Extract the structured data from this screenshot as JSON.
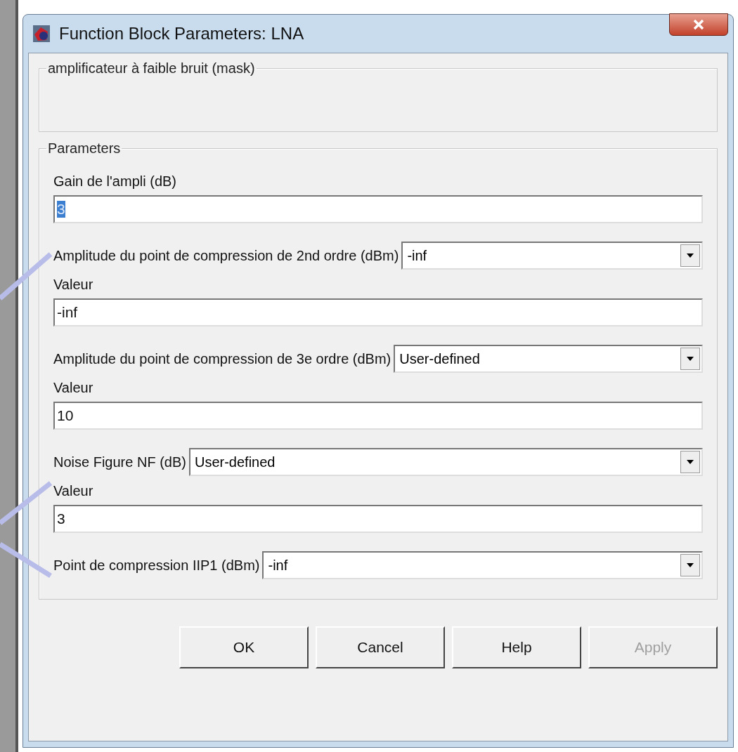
{
  "window": {
    "title": "Function Block Parameters: LNA"
  },
  "mask": {
    "title": "amplificateur à faible bruit  (mask)"
  },
  "parameters": {
    "title": "Parameters",
    "items": [
      {
        "kind": "edit",
        "label": "Gain de l'ampli (dB)",
        "value": "3",
        "selected": true
      },
      {
        "kind": "popup",
        "label": "Amplitude du point de compression de 2nd ordre (dBm)",
        "value": "-inf"
      },
      {
        "kind": "edit",
        "label": "Valeur",
        "value": "-inf",
        "selected": false
      },
      {
        "kind": "popup",
        "label": "Amplitude du point de compression de 3e ordre (dBm)",
        "value": "User-defined"
      },
      {
        "kind": "edit",
        "label": "Valeur",
        "value": "10",
        "selected": false
      },
      {
        "kind": "popup",
        "label": "Noise Figure NF  (dB)",
        "value": "User-defined"
      },
      {
        "kind": "edit",
        "label": "Valeur",
        "value": "3",
        "selected": false
      },
      {
        "kind": "popup",
        "label": "Point de compression IIP1 (dBm)",
        "value": "-inf"
      }
    ]
  },
  "buttons": [
    {
      "label": "OK",
      "disabled": false
    },
    {
      "label": "Cancel",
      "disabled": false
    },
    {
      "label": "Help",
      "disabled": false
    },
    {
      "label": "Apply",
      "disabled": true
    }
  ]
}
